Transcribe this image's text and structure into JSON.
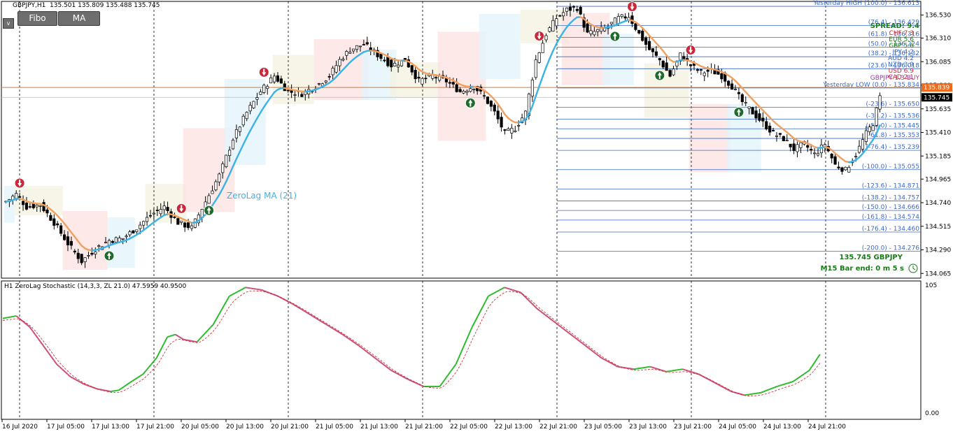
{
  "window": {
    "title": "GBPJPY,H1",
    "ohlc": "135.501 135.809 135.488 135.745",
    "indicator_title": "H1 ZeroLag Stochastic (14,3,3, ZL 21.0) 47.5959 40.9500"
  },
  "toolbar": {
    "fibo_label": "Fibo",
    "ma_label": "MA",
    "toggle_label": "v"
  },
  "info": {
    "spread": "SPREAD: 9.4",
    "signal": "GBPJPY 1.3 BUY",
    "price_symbol": "135.745  GBPJPY",
    "bar_end": "M15 Bar end: 0 m 5 s",
    "ma_label": "ZeroLag MA (21)",
    "currencies": [
      "CHF",
      "EUR",
      "GBP",
      "JPY",
      "AUD",
      "NZD",
      "USD",
      "CAD"
    ],
    "currency_values": [
      "7.3",
      "5.6",
      "5.6",
      "4.2",
      "4.2",
      "3.9",
      "6.9",
      "2.1"
    ]
  },
  "colors": {
    "bull_candle": "#ffffff",
    "bear_candle": "#000000",
    "ma_up": "#3bb3e6",
    "ma_down": "#f0a060",
    "stoch_up": "#2dbb2d",
    "stoch_down": "#c8507a",
    "fib_line": "#3a68c8",
    "price_line": "#d27a3a",
    "bid_tag": "#000000",
    "ask_tag": "#f06a1c"
  },
  "chart_data": [
    {
      "type": "candlestick",
      "symbol": "GBPJPY",
      "timeframe": "H1",
      "y_axis_ticks": [
        "136.530",
        "136.310",
        "136.085",
        "135.860",
        "135.635",
        "135.410",
        "135.185",
        "134.965",
        "134.740",
        "134.515",
        "134.290",
        "134.065"
      ],
      "x_axis_ticks": [
        "16 Jul 2020",
        "17 Jul 05:00",
        "17 Jul 13:00",
        "17 Jul 21:00",
        "20 Jul 05:00",
        "20 Jul 13:00",
        "20 Jul 21:00",
        "21 Jul 05:00",
        "21 Jul 13:00",
        "21 Jul 21:00",
        "22 Jul 05:00",
        "22 Jul 13:00",
        "22 Jul 21:00",
        "23 Jul 05:00",
        "23 Jul 13:00",
        "23 Jul 21:00",
        "24 Jul 05:00",
        "24 Jul 13:00",
        "24 Jul 21:00"
      ],
      "ylim": [
        134.02,
        136.66
      ],
      "ask_price": "135.839",
      "bid_price": "135.745",
      "anchors": [
        [
          0,
          134.75
        ],
        [
          3,
          134.82
        ],
        [
          6,
          134.7
        ],
        [
          10,
          134.72
        ],
        [
          14,
          134.55
        ],
        [
          18,
          134.35
        ],
        [
          22,
          134.18
        ],
        [
          26,
          134.3
        ],
        [
          30,
          134.38
        ],
        [
          34,
          134.4
        ],
        [
          38,
          134.5
        ],
        [
          42,
          134.62
        ],
        [
          46,
          134.7
        ],
        [
          50,
          134.55
        ],
        [
          54,
          134.5
        ],
        [
          58,
          134.75
        ],
        [
          62,
          135.0
        ],
        [
          66,
          135.35
        ],
        [
          70,
          135.6
        ],
        [
          74,
          135.8
        ],
        [
          78,
          135.95
        ],
        [
          82,
          135.8
        ],
        [
          86,
          135.78
        ],
        [
          90,
          135.85
        ],
        [
          94,
          135.95
        ],
        [
          97,
          136.1
        ],
        [
          100,
          136.2
        ],
        [
          104,
          136.25
        ],
        [
          108,
          136.15
        ],
        [
          112,
          136.05
        ],
        [
          116,
          136.1
        ],
        [
          120,
          135.9
        ],
        [
          124,
          135.95
        ],
        [
          128,
          135.9
        ],
        [
          132,
          135.8
        ],
        [
          136,
          135.85
        ],
        [
          139,
          135.75
        ],
        [
          142,
          135.6
        ],
        [
          145,
          135.4
        ],
        [
          148,
          135.45
        ],
        [
          151,
          135.6
        ],
        [
          154,
          136.1
        ],
        [
          157,
          136.35
        ],
        [
          160,
          136.5
        ],
        [
          163,
          136.58
        ],
        [
          166,
          136.6
        ],
        [
          169,
          136.35
        ],
        [
          172,
          136.38
        ],
        [
          175,
          136.42
        ],
        [
          178,
          136.5
        ],
        [
          181,
          136.52
        ],
        [
          184,
          136.35
        ],
        [
          187,
          136.2
        ],
        [
          190,
          136.1
        ],
        [
          193,
          135.95
        ],
        [
          196,
          136.15
        ],
        [
          199,
          136.05
        ],
        [
          202,
          135.98
        ],
        [
          205,
          136.0
        ],
        [
          208,
          135.95
        ],
        [
          211,
          135.85
        ],
        [
          214,
          135.7
        ],
        [
          217,
          135.6
        ],
        [
          220,
          135.5
        ],
        [
          223,
          135.4
        ],
        [
          226,
          135.35
        ],
        [
          229,
          135.25
        ],
        [
          232,
          135.3
        ],
        [
          235,
          135.2
        ],
        [
          238,
          135.3
        ],
        [
          241,
          135.1
        ],
        [
          244,
          135.05
        ],
        [
          247,
          135.2
        ],
        [
          250,
          135.4
        ],
        [
          252,
          135.5
        ],
        [
          254,
          135.745
        ]
      ],
      "fibonacci": {
        "high_label": "Yesterday HIGH (100.0) - 136.613",
        "low_label": "Yesterday LOW (0.0) - 135.834",
        "levels": [
          {
            "label": "(76.4) - 136.429",
            "price": 136.429
          },
          {
            "label": "(61.8) - 136.316",
            "price": 136.316
          },
          {
            "label": "(50.0) - 136.224",
            "price": 136.224
          },
          {
            "label": "(38.2) - 136.132",
            "price": 136.132
          },
          {
            "label": "(23.6) - 136.018",
            "price": 136.018
          },
          {
            "label": "(-23.6) - 135.650",
            "price": 135.65
          },
          {
            "label": "(-38.2) - 135.536",
            "price": 135.536
          },
          {
            "label": "(-50.0) - 135.445",
            "price": 135.445
          },
          {
            "label": "(-61.8) - 135.353",
            "price": 135.353
          },
          {
            "label": "(-76.4) - 135.239",
            "price": 135.239
          },
          {
            "label": "(-100.0) - 135.055",
            "price": 135.055
          },
          {
            "label": "(-123.6) - 134.871",
            "price": 134.871
          },
          {
            "label": "(-138.2) - 134.757",
            "price": 134.757
          },
          {
            "label": "(-150.0) - 134.666",
            "price": 134.666
          },
          {
            "label": "(-161.8) - 134.574",
            "price": 134.574
          },
          {
            "label": "(-176.4) - 134.460",
            "price": 134.46
          },
          {
            "label": "(-200.0) - 134.276",
            "price": 134.276
          }
        ]
      }
    },
    {
      "type": "line",
      "name": "H1 ZeroLag Stochastic (14,3,3, ZL 21.0)",
      "y_axis_ticks": [
        "105",
        "0.00"
      ],
      "ylim": [
        0,
        105
      ],
      "anchors": [
        [
          0,
          77
        ],
        [
          5,
          79
        ],
        [
          10,
          70
        ],
        [
          15,
          55
        ],
        [
          20,
          40
        ],
        [
          25,
          30
        ],
        [
          30,
          24
        ],
        [
          35,
          20
        ],
        [
          40,
          18
        ],
        [
          43,
          19
        ],
        [
          47,
          25
        ],
        [
          52,
          32
        ],
        [
          57,
          45
        ],
        [
          61,
          62
        ],
        [
          64,
          64
        ],
        [
          67,
          60
        ],
        [
          72,
          58
        ],
        [
          78,
          72
        ],
        [
          84,
          95
        ],
        [
          90,
          102
        ],
        [
          96,
          100
        ],
        [
          102,
          95
        ],
        [
          108,
          88
        ],
        [
          114,
          80
        ],
        [
          120,
          72
        ],
        [
          126,
          64
        ],
        [
          132,
          55
        ],
        [
          138,
          45
        ],
        [
          144,
          35
        ],
        [
          150,
          28
        ],
        [
          156,
          22
        ],
        [
          162,
          22
        ],
        [
          168,
          40
        ],
        [
          174,
          70
        ],
        [
          180,
          95
        ],
        [
          186,
          102
        ],
        [
          192,
          98
        ],
        [
          198,
          85
        ],
        [
          204,
          75
        ],
        [
          210,
          65
        ],
        [
          216,
          55
        ],
        [
          222,
          45
        ],
        [
          228,
          38
        ],
        [
          234,
          36
        ],
        [
          240,
          38
        ],
        [
          246,
          34
        ],
        [
          252,
          36
        ],
        [
          258,
          32
        ],
        [
          264,
          25
        ],
        [
          270,
          18
        ],
        [
          275,
          15
        ],
        [
          281,
          17
        ],
        [
          287,
          22
        ],
        [
          293,
          26
        ],
        [
          299,
          35
        ],
        [
          303,
          48
        ]
      ]
    }
  ]
}
